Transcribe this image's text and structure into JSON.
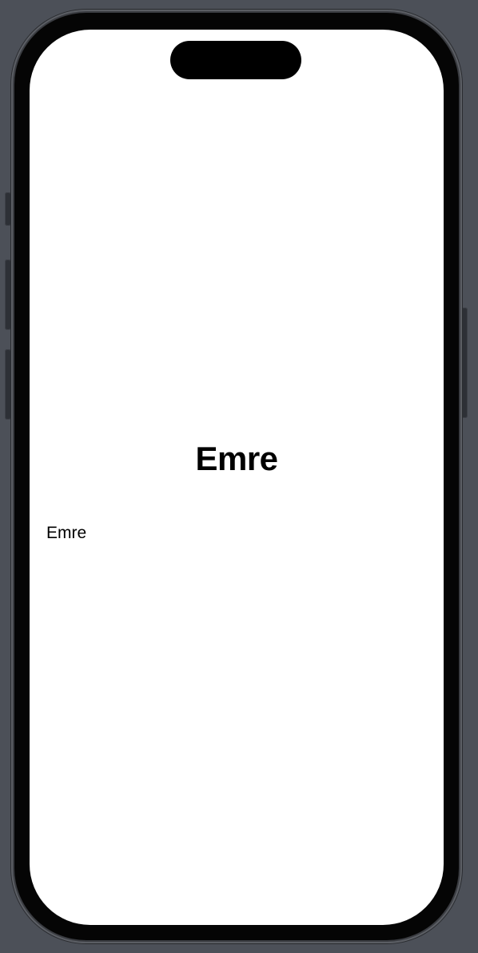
{
  "screen": {
    "heading": "Emre",
    "body_text": "Emre"
  },
  "colors": {
    "background": "#4c5058",
    "screen": "#ffffff",
    "text": "#000000"
  }
}
